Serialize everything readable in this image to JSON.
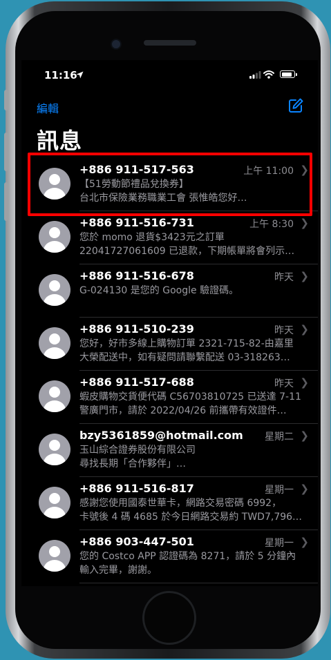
{
  "status_bar": {
    "time": "11:16"
  },
  "header": {
    "edit_label": "編輯",
    "title": "訊息"
  },
  "icons": {
    "location": "location-arrow-icon",
    "signal": "signal-icon",
    "wifi": "wifi-icon",
    "battery": "battery-icon",
    "compose": "compose-icon",
    "avatar": "person-icon",
    "chevron": "chevron-right-icon"
  },
  "colors": {
    "accent": "#0a84ff",
    "highlight": "#ff0000",
    "background": "#000000"
  },
  "conversations": [
    {
      "name": "+886 911-517-563",
      "time": "上午 11:00",
      "line1": "【51勞動節禮品兌換券】",
      "line2": "台北市保險業務職業工會 張惟皓您好…"
    },
    {
      "name": "+886 911-516-731",
      "time": "上午 8:30",
      "line1": "您於 momo 退貨$3423元之訂單",
      "line2": "22041727061609 已退款，下期帳單將會列示…"
    },
    {
      "name": "+886 911-516-678",
      "time": "昨天",
      "line1": "G-024130 是您的 Google 驗證碼。",
      "line2": ""
    },
    {
      "name": "+886 911-510-239",
      "time": "昨天",
      "line1": "您好，好市多線上購物訂單 2321-715-82-由嘉里",
      "line2": "大榮配送中，如有疑問請聯繫配送 03-318263…"
    },
    {
      "name": "+886 911-517-688",
      "time": "昨天",
      "line1": "蝦皮購物交貨便代碼 C56703810725 已送達 7-11",
      "line2": "警廣門市，請於 2022/04/26 前攜帶有效證件…"
    },
    {
      "name": "bzy5361859@hotmail.com",
      "time": "星期二",
      "line1": "玉山綜合證券股份有限公司",
      "line2": "尋找長期「合作夥伴」…"
    },
    {
      "name": "+886 911-516-817",
      "time": "星期一",
      "line1": "感謝您使用國泰世華卡，網路交易密碼 6992，",
      "line2": "卡號後 4 碼 4685 於今日網路交易約 TWD7,796…"
    },
    {
      "name": "+886 903-447-501",
      "time": "星期一",
      "line1": "您的 Costco APP 認證碼為 8271，請於 5 分鐘內",
      "line2": "輸入完畢，謝謝。"
    }
  ]
}
